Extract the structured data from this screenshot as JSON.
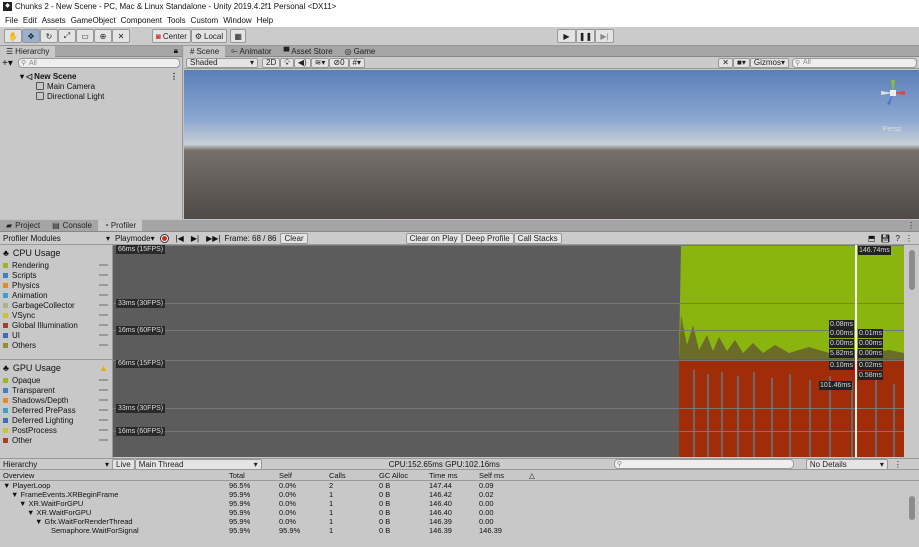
{
  "window_title": "Chunks 2 - New Scene - PC, Mac & Linux Standalone - Unity 2019.4.2f1 Personal <DX11>",
  "menu": [
    "File",
    "Edit",
    "Assets",
    "GameObject",
    "Component",
    "Tools",
    "Custom",
    "Window",
    "Help"
  ],
  "toolbar": {
    "center": "Center",
    "local": "Local"
  },
  "hierarchy": {
    "tab": "Hierarchy",
    "search_placeholder": "All",
    "scene": "New Scene",
    "items": [
      "Main Camera",
      "Directional Light"
    ]
  },
  "scene_tabs": [
    "Scene",
    "Animator",
    "Asset Store",
    "Game"
  ],
  "scene_bar": {
    "shading": "Shaded",
    "mode2d": "2D",
    "gizmos": "Gizmos",
    "search_placeholder": "All",
    "hidden_count": "0",
    "persp": "Persp"
  },
  "bottom_tabs": [
    "Project",
    "Console",
    "Profiler"
  ],
  "profiler_bar": {
    "modules": "Profiler Modules",
    "playmode": "Playmode",
    "frame": "Frame: 68 / 86",
    "clear": "Clear",
    "clear_on_play": "Clear on Play",
    "deep_profile": "Deep Profile",
    "call_stacks": "Call Stacks"
  },
  "cpu": {
    "title": "CPU Usage",
    "legend": [
      {
        "name": "Rendering",
        "color": "#9bb52a"
      },
      {
        "name": "Scripts",
        "color": "#3f82c2"
      },
      {
        "name": "Physics",
        "color": "#e38a2b"
      },
      {
        "name": "Animation",
        "color": "#3aa2c9"
      },
      {
        "name": "GarbageCollector",
        "color": "#a9b28c"
      },
      {
        "name": "VSync",
        "color": "#c9c23a"
      },
      {
        "name": "Global Illumination",
        "color": "#a63d2e"
      },
      {
        "name": "UI",
        "color": "#3c6fb5"
      },
      {
        "name": "Others",
        "color": "#8f8f3a"
      }
    ],
    "lines": [
      "66ms (15FPS)",
      "33ms (30FPS)",
      "16ms (60FPS)"
    ],
    "top_value": "146.74ms",
    "values": [
      "0.08ms",
      "0.00ms",
      "0.01ms",
      "0.00ms",
      "0.00ms",
      "5.82ms",
      "0.00ms"
    ]
  },
  "gpu": {
    "title": "GPU Usage",
    "legend": [
      {
        "name": "Opaque",
        "color": "#9bb52a"
      },
      {
        "name": "Transparent",
        "color": "#3f82c2"
      },
      {
        "name": "Shadows/Depth",
        "color": "#e38a2b"
      },
      {
        "name": "Deferred PrePass",
        "color": "#3aa2c9"
      },
      {
        "name": "Deferred Lighting",
        "color": "#3c6fb5"
      },
      {
        "name": "PostProcess",
        "color": "#c9c23a"
      },
      {
        "name": "Other",
        "color": "#a63d2e"
      }
    ],
    "lines": [
      "66ms (15FPS)",
      "33ms (30FPS)",
      "16ms (60FPS)"
    ],
    "values": [
      "0.10ms",
      "0.02ms",
      "0.58ms",
      "101.46ms"
    ]
  },
  "details": {
    "view": "Hierarchy",
    "live": "Live",
    "thread": "Main Thread",
    "timing": "CPU:152.65ms  GPU:102.16ms",
    "no_details": "No Details",
    "columns": [
      "Overview",
      "Total",
      "Self",
      "Calls",
      "GC Alloc",
      "Time ms",
      "Self ms"
    ],
    "rows": [
      [
        "PlayerLoop",
        "96.5%",
        "0.0%",
        "2",
        "0 B",
        "147.44",
        "0.09"
      ],
      [
        "FrameEvents.XRBeginFrame",
        "95.9%",
        "0.0%",
        "1",
        "0 B",
        "146.42",
        "0.02"
      ],
      [
        "XR.WaitForGPU",
        "95.9%",
        "0.0%",
        "1",
        "0 B",
        "146.40",
        "0.00"
      ],
      [
        "XR.WaitForGPU",
        "95.9%",
        "0.0%",
        "1",
        "0 B",
        "146.40",
        "0.00"
      ],
      [
        "Gfx.WaitForRenderThread",
        "95.9%",
        "0.0%",
        "1",
        "0 B",
        "146.39",
        "0.00"
      ],
      [
        "Semaphore.WaitForSignal",
        "95.9%",
        "95.9%",
        "1",
        "0 B",
        "146.39",
        "146.39"
      ]
    ]
  }
}
